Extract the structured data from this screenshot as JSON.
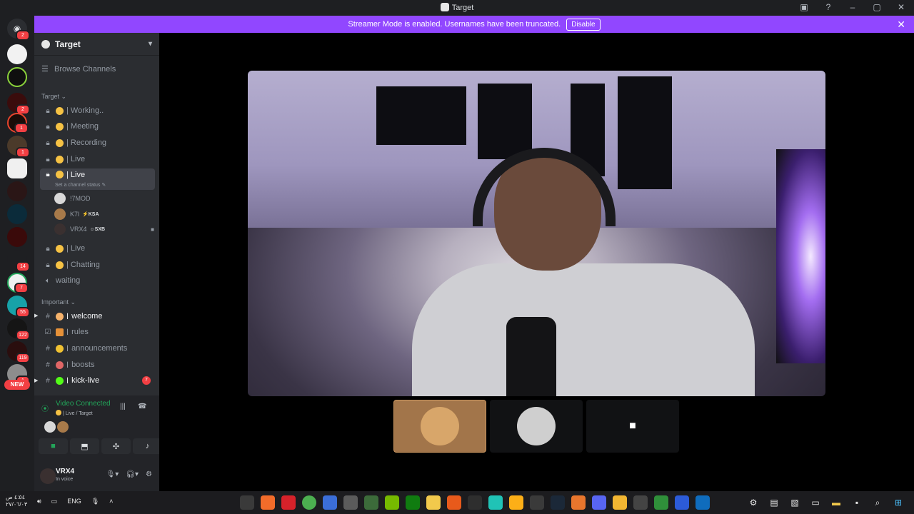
{
  "window": {
    "title": "Target",
    "controls": [
      "minimize",
      "maximize",
      "close"
    ]
  },
  "banner": {
    "message": "Streamer Mode is enabled. Usernames have been truncated.",
    "disable_label": "Disable",
    "color": "#9147ff"
  },
  "rail": {
    "badges": [
      "2",
      "2",
      "1",
      "1",
      "14",
      "7",
      "55",
      "122",
      "119",
      "1"
    ],
    "new_label": "NEW"
  },
  "server": {
    "name": "Target",
    "browse_label": "Browse Channels",
    "category_target": "Target",
    "category_important": "Important",
    "channels": [
      {
        "name": "| Working.."
      },
      {
        "name": "| Meeting"
      },
      {
        "name": "| Recording"
      },
      {
        "name": "| Live"
      },
      {
        "name": "| Live",
        "status": "Set a channel status"
      },
      {
        "name": "| Live"
      },
      {
        "name": "| Chatting"
      },
      {
        "name": "waiting"
      }
    ],
    "members": [
      {
        "name": "!7MOD",
        "tag": ""
      },
      {
        "name": "K7l",
        "tag": "KSA"
      },
      {
        "name": "VRX4",
        "tag": "SXB"
      }
    ],
    "text_channels": [
      {
        "name": "welcome"
      },
      {
        "name": "rules"
      },
      {
        "name": "announcements"
      },
      {
        "name": "boosts"
      },
      {
        "name": "kick-live",
        "badge": "7"
      }
    ]
  },
  "voice_panel": {
    "title": "Video Connected",
    "subtitle": "| Live / Target",
    "status_color": "#23a55a"
  },
  "user": {
    "name": "VRX4",
    "status": "In voice"
  },
  "taskbar": {
    "time": "٤:٥٤ ص",
    "date": "٢٧/٠٦/٠٣",
    "lang": "ENG"
  },
  "colors": {
    "sidebar": "#2b2d31",
    "rail": "#1e1f22",
    "accent_red": "#f23f43"
  }
}
